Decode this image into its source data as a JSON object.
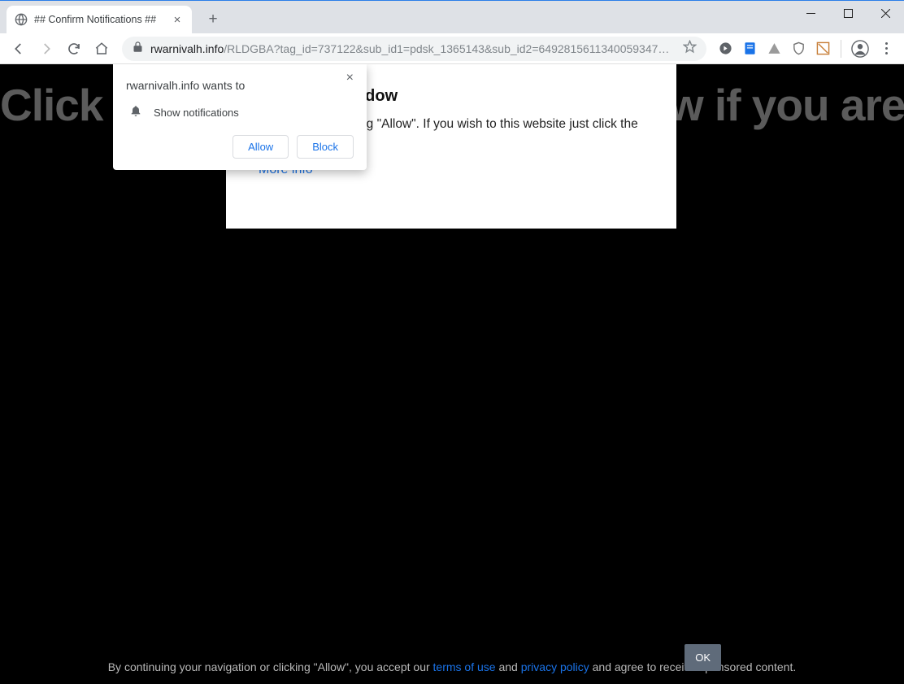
{
  "tab": {
    "title": "## Confirm Notifications ##"
  },
  "url": {
    "host": "rwarnivalh.info",
    "path": "/RLDGBA?tag_id=737122&sub_id1=pdsk_1365143&sub_id2=6492815611340059347&c..."
  },
  "page": {
    "bigText": "Click \"Allow\" to close this window if you are not a ",
    "box": {
      "title": "close this window",
      "body": "e closed by pressing \"Allow\". If you wish to this website just click the more info button",
      "more": "More info"
    },
    "footer": {
      "t1": "By continuing your navigation or clicking \"Allow\", you accept our ",
      "terms": "terms of use",
      "t2": " and ",
      "privacy": "privacy policy",
      "t3": " and agree to receive sponsored content.",
      "ok": "OK"
    }
  },
  "perm": {
    "site": "rwarnivalh.info wants to",
    "label": "Show notifications",
    "allow": "Allow",
    "block": "Block"
  }
}
